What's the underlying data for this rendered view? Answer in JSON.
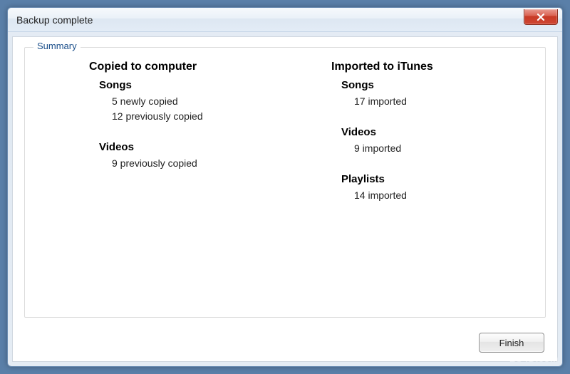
{
  "window": {
    "title": "Backup complete"
  },
  "group": {
    "label": "Summary"
  },
  "columns": {
    "left": {
      "heading": "Copied to computer",
      "songs": {
        "title": "Songs",
        "line1": "5 newly copied",
        "line2": "12 previously copied"
      },
      "videos": {
        "title": "Videos",
        "line1": "9 previously copied"
      }
    },
    "right": {
      "heading": "Imported to iTunes",
      "songs": {
        "title": "Songs",
        "line1": "17 imported"
      },
      "videos": {
        "title": "Videos",
        "line1": "9 imported"
      },
      "playlists": {
        "title": "Playlists",
        "line1": "14 imported"
      }
    }
  },
  "buttons": {
    "finish": "Finish"
  },
  "watermark": "LO4D.com"
}
